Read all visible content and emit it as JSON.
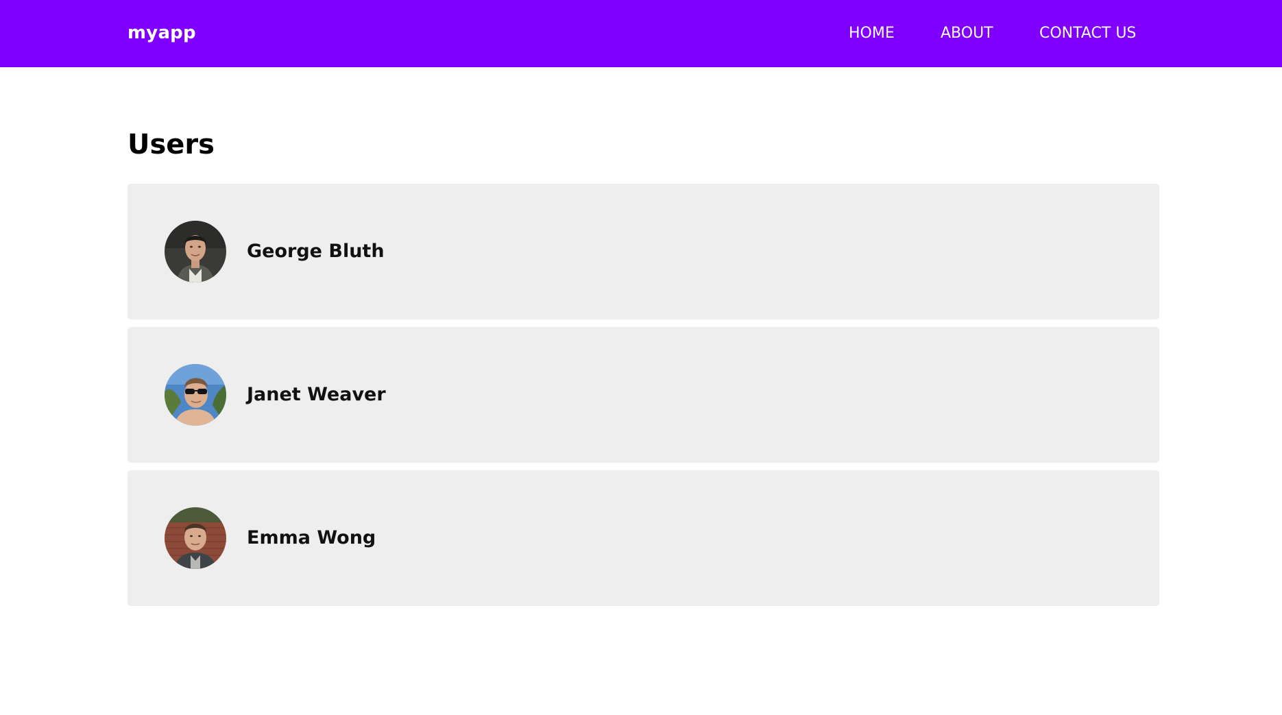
{
  "navbar": {
    "brand": "myapp",
    "background": "#7f00ff",
    "links": [
      {
        "label": "HOME"
      },
      {
        "label": "ABOUT"
      },
      {
        "label": "CONTACT US"
      }
    ]
  },
  "main": {
    "title": "Users",
    "users": [
      {
        "name": "George Bluth",
        "avatar": "avatar-photo"
      },
      {
        "name": "Janet Weaver",
        "avatar": "avatar-photo"
      },
      {
        "name": "Emma Wong",
        "avatar": "avatar-photo"
      }
    ]
  }
}
